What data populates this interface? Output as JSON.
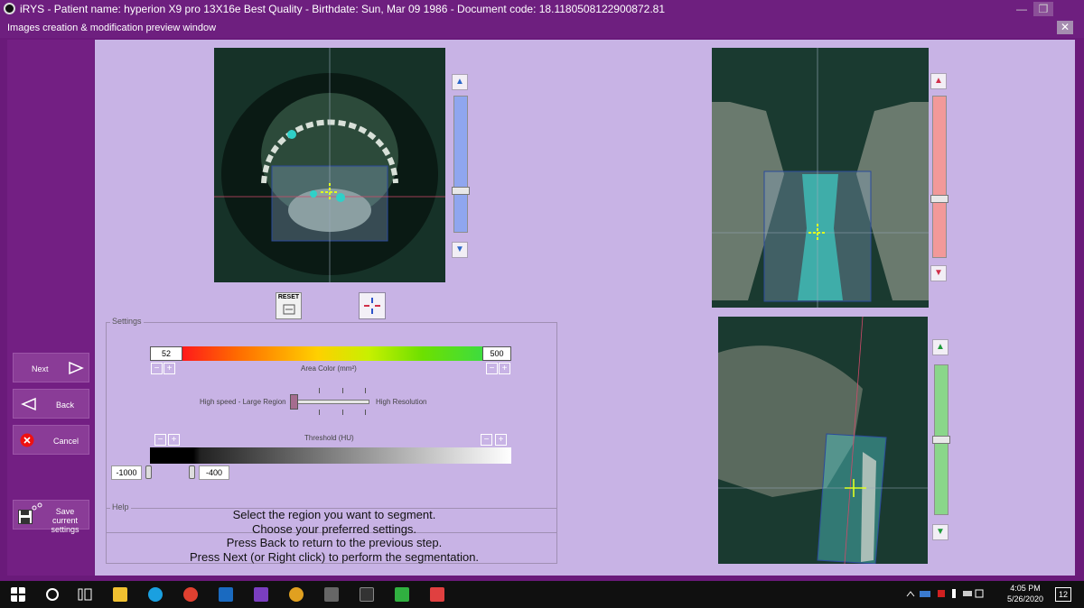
{
  "window": {
    "title": "iRYS - Patient name: hyperion X9 pro 13X16e  Best Quality - Birthdate: Sun, Mar 09 1986 - Document code: 18.11805081229008​72.81",
    "subtitle": "Images creation & modification preview window"
  },
  "sidebar": {
    "next_label": "Next",
    "back_label": "Back",
    "cancel_label": "Cancel",
    "save_label_line1": "Save current",
    "save_label_line2": "settings"
  },
  "views": {
    "reset_label": "RESET"
  },
  "settings": {
    "legend": "Settings",
    "area_min": "52",
    "area_max": "500",
    "area_color_label": "Area Color (mm²)",
    "speed_left_label": "High speed - Large Region",
    "speed_right_label": "High Resolution",
    "threshold_label": "Threshold (HU)",
    "threshold_min": "-1000",
    "threshold_value": "-400"
  },
  "help": {
    "legend": "Help",
    "line1": "Select the region you want to segment.",
    "line2": "Choose your preferred settings.",
    "line3": "Press Back to return to the previous step.",
    "line4": "Press Next (or Right click) to perform the segmentation."
  },
  "taskbar": {
    "time": "4:05 PM",
    "date": "5/26/2020",
    "notif_count": "12"
  }
}
